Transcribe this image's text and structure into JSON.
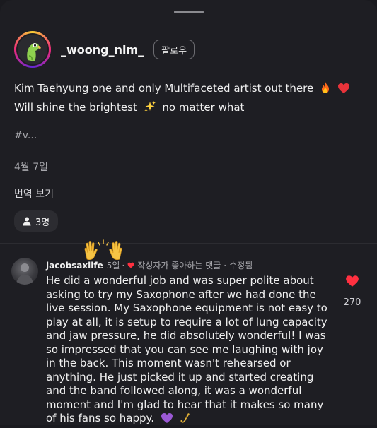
{
  "post": {
    "username": "_woong_nim_",
    "follow_label": "팔로우",
    "caption_line1": "Kim Taehyung one and only Multifaceted artist out there",
    "caption_line2": "Will shine the brightest",
    "caption_line2_tail": "no matter what",
    "hashtag": "#v...",
    "date": "4월 7일",
    "translate_label": "번역 보기",
    "likes_count": "3명"
  },
  "comment": {
    "author": "jacobsaxlife",
    "age": "5일",
    "liked_by_creator": "작성자가 좋아하는 댓글",
    "edited": "수정됨",
    "dot1": "·",
    "dot2": "·",
    "lines": [
      "He did a wonderful job and was super polite about",
      "asking to try my Saxophone after we had done the",
      "live session. My Saxophone equipment is not easy to",
      "play at all, it is setup to require a lot of lung capacity",
      "and jaw pressure, he did absolutely wonderful! I was",
      "so impressed that you can see me laughing with joy",
      "in the back. This moment wasn't rehearsed or",
      "anything. He just picked it up and started creating",
      "and the band followed along, it was a wonderful",
      "moment and I'm glad to hear that it makes so many",
      "of his fans so happy."
    ],
    "like_count": "270"
  },
  "icons": {
    "fire": "fire-emoji",
    "heart": "red-heart-emoji",
    "sparkles": "sparkles-emoji",
    "person": "person-icon",
    "clap": "raising-hands-emoji",
    "purple_heart": "purple-heart-emoji",
    "saxophone": "saxophone-emoji"
  },
  "colors": {
    "background": "#1e1e23",
    "like_red": "#ff3040",
    "muted_text": "#a7a7ac"
  }
}
